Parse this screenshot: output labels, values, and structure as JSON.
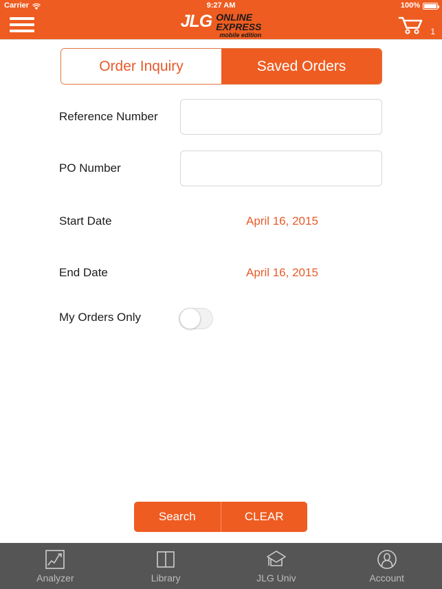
{
  "status_bar": {
    "carrier": "Carrier",
    "wifi_icon": "wifi-icon",
    "time": "9:27 AM",
    "battery_percent": "100%",
    "battery_icon": "battery-full-icon"
  },
  "header": {
    "menu_icon": "hamburger-menu-icon",
    "logo": {
      "brand": "JLG",
      "line1": "ONLINE",
      "line2": "EXPRESS",
      "line3": "mobile edition"
    },
    "cart_icon": "shopping-cart-icon",
    "cart_count": "1",
    "background_color": "#EE5C21"
  },
  "tabs": {
    "items": [
      {
        "label": "Order Inquiry",
        "active": false
      },
      {
        "label": "Saved Orders",
        "active": true
      }
    ]
  },
  "form": {
    "reference_number": {
      "label": "Reference Number",
      "value": "",
      "placeholder": ""
    },
    "po_number": {
      "label": "PO Number",
      "value": "",
      "placeholder": ""
    },
    "start_date": {
      "label": "Start Date",
      "value": "April 16, 2015"
    },
    "end_date": {
      "label": "End Date",
      "value": "April 16, 2015"
    },
    "my_orders_only": {
      "label": "My Orders Only",
      "value": "off"
    }
  },
  "actions": {
    "search_label": "Search",
    "clear_label": "CLEAR"
  },
  "tabbar": {
    "items": [
      {
        "label": "Analyzer",
        "icon": "chart-analyzer-icon"
      },
      {
        "label": "Library",
        "icon": "open-book-icon"
      },
      {
        "label": "JLG Univ",
        "icon": "graduation-cap-icon"
      },
      {
        "label": "Account",
        "icon": "user-account-icon"
      }
    ],
    "background_color": "#555555"
  },
  "colors": {
    "brand_orange": "#EE5C21",
    "accent_text_orange": "#E75B2B",
    "tabbar_gray": "#555555"
  }
}
